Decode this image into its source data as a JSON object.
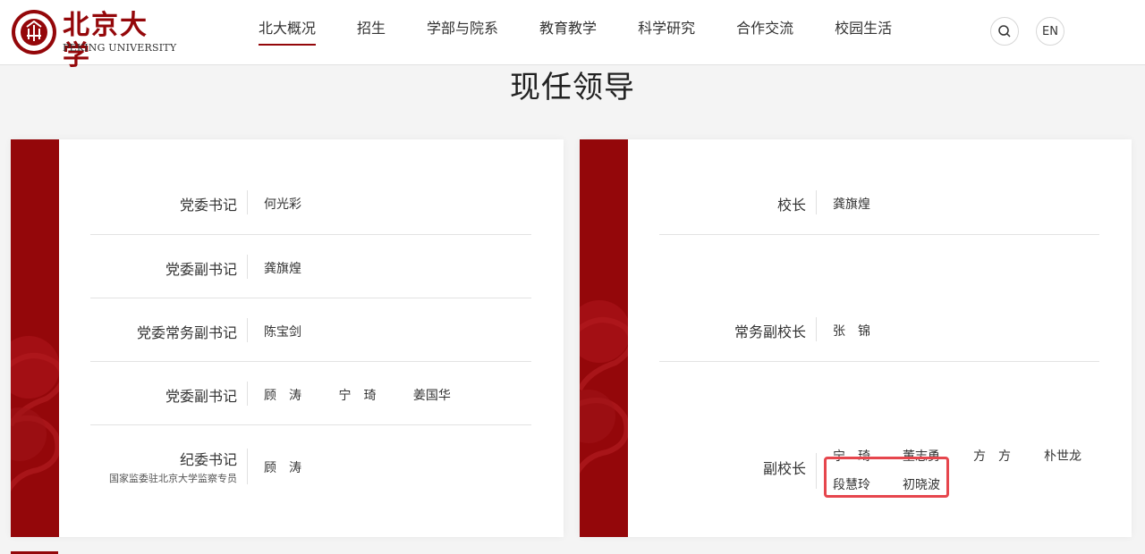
{
  "header": {
    "logo_cn": "北京大学",
    "logo_en": "PEKING UNIVERSITY",
    "nav": [
      {
        "label": "北大概况",
        "active": true
      },
      {
        "label": "招生",
        "active": false
      },
      {
        "label": "学部与院系",
        "active": false
      },
      {
        "label": "教育教学",
        "active": false
      },
      {
        "label": "科学研究",
        "active": false
      },
      {
        "label": "合作交流",
        "active": false
      },
      {
        "label": "校园生活",
        "active": false
      }
    ],
    "search_icon": "search-icon",
    "lang_label": "EN"
  },
  "page_title": "现任领导",
  "left_card": {
    "rows": [
      {
        "role": "党委书记",
        "names": [
          "何光彩"
        ]
      },
      {
        "role": "党委副书记",
        "names": [
          "龚旗煌"
        ]
      },
      {
        "role": "党委常务副书记",
        "names": [
          "陈宝剑"
        ]
      },
      {
        "role": "党委副书记",
        "names": [
          "顾　涛",
          "宁　琦",
          "姜国华"
        ]
      },
      {
        "role": "纪委书记",
        "role_sub": "国家监委驻北京大学监察专员",
        "names": [
          "顾　涛"
        ]
      }
    ]
  },
  "right_card": {
    "rows": [
      {
        "role": "校长",
        "names": [
          "龚旗煌"
        ]
      },
      {
        "role": "常务副校长",
        "names": [
          "张　锦"
        ]
      },
      {
        "role": "副校长",
        "names": [
          "宁　琦",
          "董志勇",
          "方　方",
          "朴世龙",
          "段慧玲",
          "初晓波"
        ]
      }
    ]
  },
  "colors": {
    "brand_red": "#94070a",
    "highlight": "#e6464d"
  }
}
